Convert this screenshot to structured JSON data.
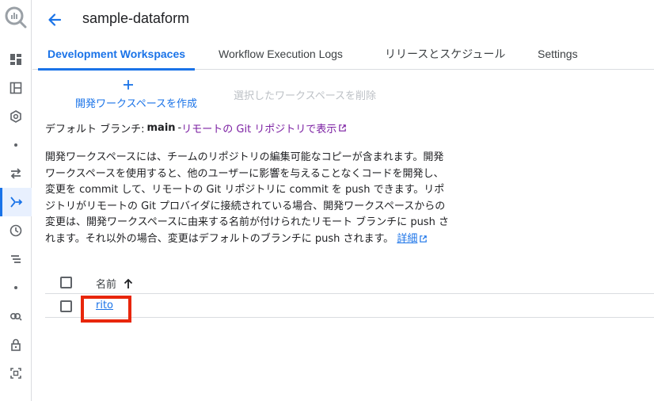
{
  "header": {
    "title": "sample-dataform"
  },
  "tabs": [
    {
      "label": "Development Workspaces"
    },
    {
      "label": "Workflow Execution Logs"
    },
    {
      "label": "リリースとスケジュール"
    },
    {
      "label": "Settings"
    }
  ],
  "actions": {
    "create_label": "開発ワークスペースを作成",
    "delete_label": "選択したワークスペースを削除"
  },
  "branch": {
    "prefix": "デフォルト ブランチ:",
    "name": "main",
    "separator": "-",
    "link_label": "リモートの Git リポジトリで表示"
  },
  "description": {
    "text": "開発ワークスペースには、チームのリポジトリの編集可能なコピーが含まれます。開発ワークスペースを使用すると、他のユーザーに影響を与えることなくコードを開発し、変更を commit して、リモートの Git リポジトリに commit を push できます。リポジトリがリモートの Git プロバイダに接続されている場合、開発ワークスペースからの変更は、開発ワークスペースに由来する名前が付けられたリモート ブランチに push されます。それ以外の場合、変更はデフォルトのブランチに push されます。",
    "learn_more": "詳細"
  },
  "table": {
    "column_name": "名前",
    "rows": [
      {
        "name": "rito"
      }
    ]
  },
  "colors": {
    "accent": "#1a73e8",
    "link_visited": "#7b1fa2",
    "highlight": "#e8260b"
  },
  "icons": {
    "rail": [
      "bigquery-logo",
      "dashboard-icon",
      "explorer-icon",
      "hexagon-icon",
      "dot-icon",
      "transfer-icon",
      "dataform-icon",
      "clock-icon",
      "list-icon",
      "dot-icon",
      "link-icon",
      "lock-icon",
      "scan-icon"
    ]
  }
}
